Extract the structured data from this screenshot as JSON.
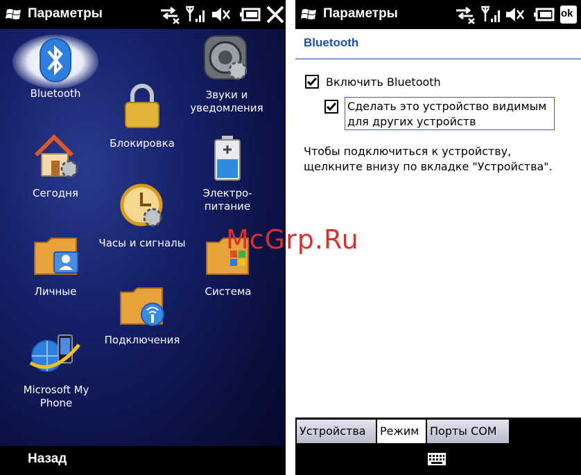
{
  "left": {
    "title": "Параметры",
    "apps": [
      {
        "label": "Bluetooth"
      },
      {
        "label": "Звуки и уведомления"
      },
      {
        "label": "Блокировка"
      },
      {
        "label": "Сегодня"
      },
      {
        "label": "Электро-питание"
      },
      {
        "label": "Часы и сигналы"
      },
      {
        "label": "Личные"
      },
      {
        "label": "Система"
      },
      {
        "label": "Подключения"
      },
      {
        "label": "Microsoft My Phone"
      }
    ],
    "softkey": "Назад",
    "close_icon": "close-x-icon"
  },
  "right": {
    "title": "Параметры",
    "ok_label": "ok",
    "header": "Bluetooth",
    "enable_bt": {
      "label": "Включить Bluetooth",
      "checked": true
    },
    "visible": {
      "line1": "Сделать это устройство видимым",
      "line2": "для других устройств",
      "checked": true
    },
    "info_line1": "Чтобы подключиться к устройству,",
    "info_line2": "щелкните внизу по вкладке \"Устройства\".",
    "tabs": [
      {
        "label": "Устройства",
        "active": false
      },
      {
        "label": "Режим",
        "active": true
      },
      {
        "label": "Порты COM",
        "active": false
      }
    ]
  },
  "watermark": "McGrp.Ru",
  "colors": {
    "accent": "#1a4fae",
    "watermark": "#d4312f"
  }
}
